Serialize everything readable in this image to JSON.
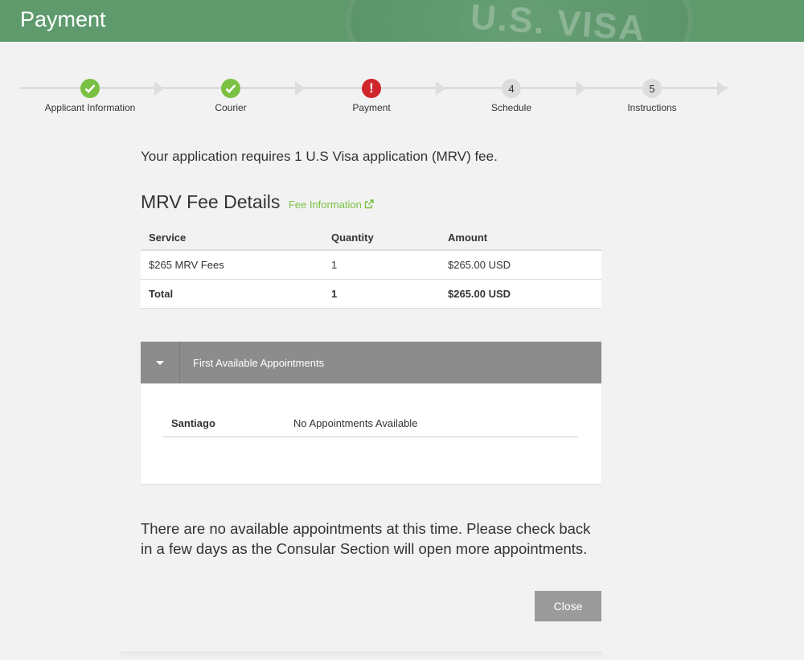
{
  "header": {
    "title": "Payment",
    "watermark": "U.S. VISA"
  },
  "stepper": [
    {
      "label": "Applicant Information",
      "state": "done",
      "marker": "✓"
    },
    {
      "label": "Courier",
      "state": "done",
      "marker": "✓"
    },
    {
      "label": "Payment",
      "state": "error",
      "marker": "!"
    },
    {
      "label": "Schedule",
      "state": "todo",
      "marker": "4"
    },
    {
      "label": "Instructions",
      "state": "todo",
      "marker": "5"
    }
  ],
  "intro": "Your application requires 1 U.S Visa application (MRV) fee.",
  "fee_details": {
    "title": "MRV Fee Details",
    "link_label": "Fee Information",
    "columns": [
      "Service",
      "Quantity",
      "Amount"
    ],
    "rows": [
      {
        "service": "$265 MRV Fees",
        "quantity": "1",
        "amount": "$265.00 USD"
      }
    ],
    "total": {
      "service": "Total",
      "quantity": "1",
      "amount": "$265.00 USD"
    }
  },
  "appointments": {
    "title": "First Available Appointments",
    "rows": [
      {
        "city": "Santiago",
        "status": "No Appointments Available"
      }
    ]
  },
  "notice": "There are no available appointments at this time. Please check back in a few days as the Consular Section will open more appointments.",
  "close_label": "Close",
  "colors": {
    "header": "#5f9a6d",
    "done": "#7ac143",
    "error": "#d0252b",
    "link": "#7ac143"
  }
}
